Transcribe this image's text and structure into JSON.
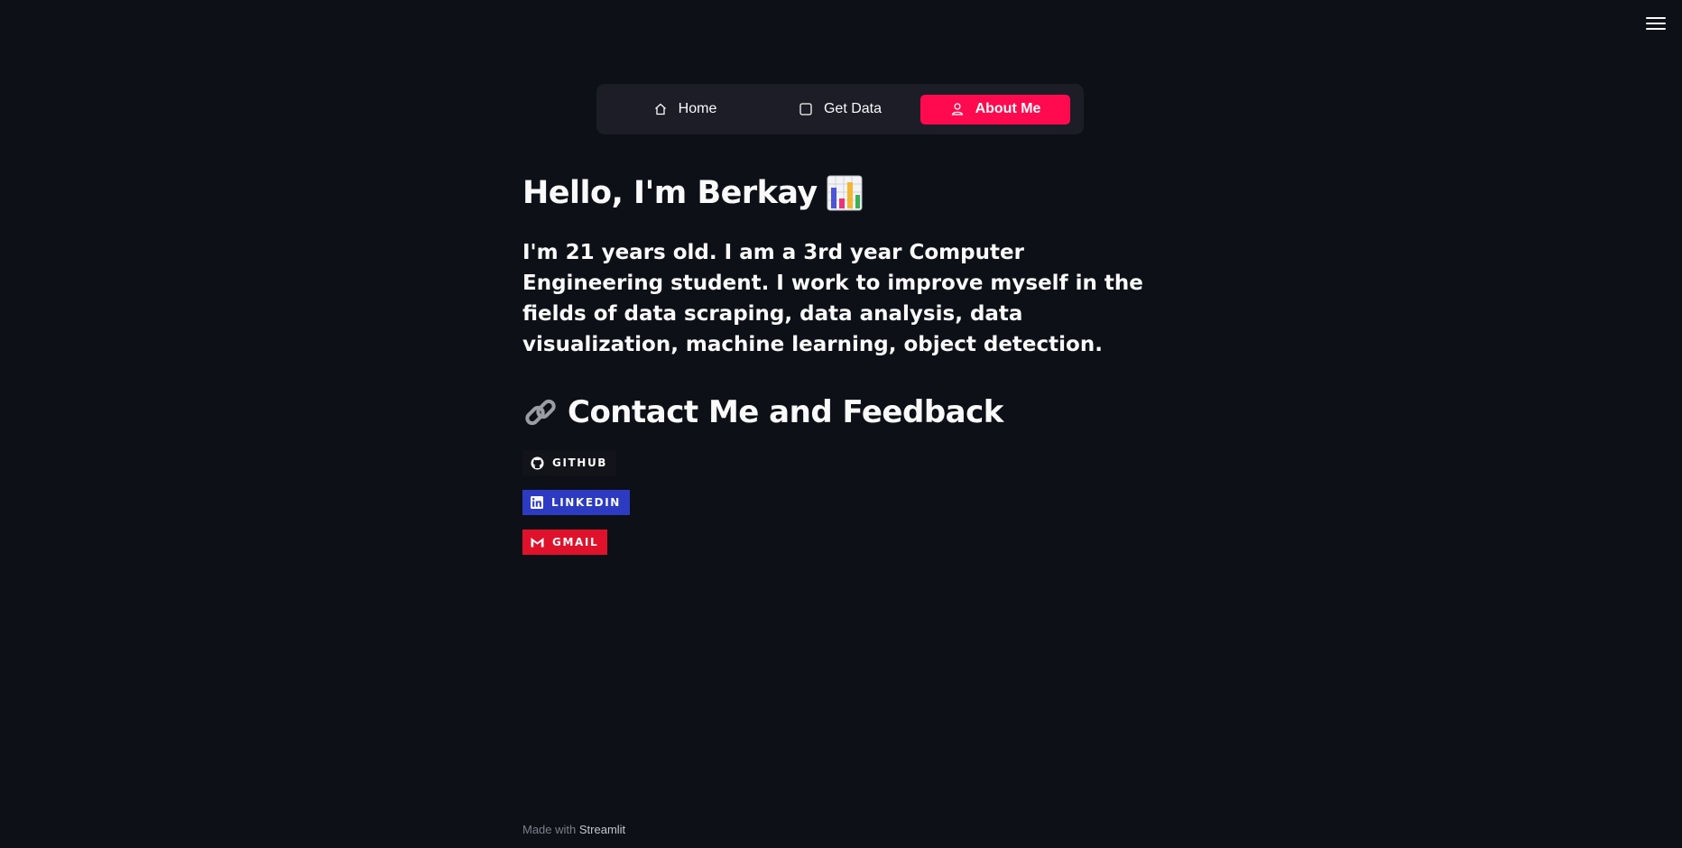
{
  "nav": {
    "items": [
      {
        "label": "Home",
        "icon": "home-icon",
        "active": false
      },
      {
        "label": "Get Data",
        "icon": "square-icon",
        "active": false
      },
      {
        "label": "About Me",
        "icon": "person-icon",
        "active": true
      }
    ]
  },
  "about": {
    "title": "Hello, I'm Berkay",
    "title_emoji": "bar-chart-icon",
    "intro": "I'm 21 years old. I am a 3rd year Computer Engineering student. I work to improve myself in the fields of data scraping, data analysis, data visualization, machine learning, object detection.",
    "contact_heading": "Contact Me and Feedback",
    "contact_emoji": "link-icon"
  },
  "badges": [
    {
      "label": "GITHUB",
      "icon": "github-icon",
      "color": "#13131a"
    },
    {
      "label": "LINKEDIN",
      "icon": "linkedin-icon",
      "color": "#2d3ac2"
    },
    {
      "label": "GMAIL",
      "icon": "gmail-icon",
      "color": "#e0112b"
    }
  ],
  "footer": {
    "prefix": "Made with ",
    "brand": "Streamlit"
  },
  "colors": {
    "background": "#0e1018",
    "nav_background": "#1c1d26",
    "accent": "#ff0a4e"
  }
}
